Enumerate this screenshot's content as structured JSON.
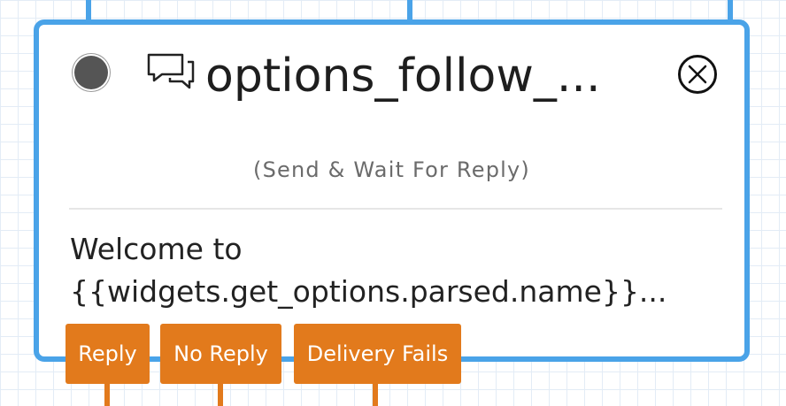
{
  "node": {
    "title": "options_follow_...",
    "subtitle": "(Send & Wait For Reply)",
    "body_line_1": "Welcome to",
    "body_line_2": "{{widgets.get_options.parsed.name}}...",
    "status_icon": "status-dot-icon",
    "type_icon": "chat-bubbles-icon",
    "close_icon": "close-circle-icon"
  },
  "branches": [
    {
      "label": "Reply"
    },
    {
      "label": "No Reply"
    },
    {
      "label": "Delivery Fails"
    }
  ],
  "colors": {
    "node_border": "#4aa3e8",
    "branch": "#e27a1c",
    "grid": "#e3ecf6"
  }
}
